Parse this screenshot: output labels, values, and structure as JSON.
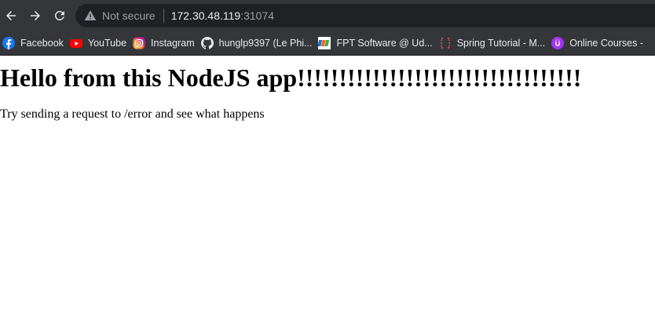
{
  "browser": {
    "address_bar": {
      "security_label": "Not secure",
      "url_host": "172.30.48.119",
      "url_port": ":31074"
    },
    "bookmarks": [
      {
        "label": "Facebook",
        "icon": "facebook-icon"
      },
      {
        "label": "YouTube",
        "icon": "youtube-icon"
      },
      {
        "label": "Instagram",
        "icon": "instagram-icon"
      },
      {
        "label": "hunglp9397 (Le Phi...",
        "icon": "github-icon"
      },
      {
        "label": "FPT Software @ Ud...",
        "icon": "fpt-icon"
      },
      {
        "label": "Spring Tutorial - M...",
        "icon": "spring-tutorial-icon"
      },
      {
        "label": "Online Courses -",
        "icon": "udemy-icon"
      }
    ]
  },
  "page": {
    "heading": "Hello from this NodeJS app!!!!!!!!!!!!!!!!!!!!!!!!!!!!!!!!!!",
    "message": "Try sending a request to /error and see what happens"
  },
  "colors": {
    "toolbar_bg": "#35363a",
    "omnibox_bg": "#202124",
    "text_light": "#e8eaed",
    "text_muted": "#9aa0a6"
  }
}
